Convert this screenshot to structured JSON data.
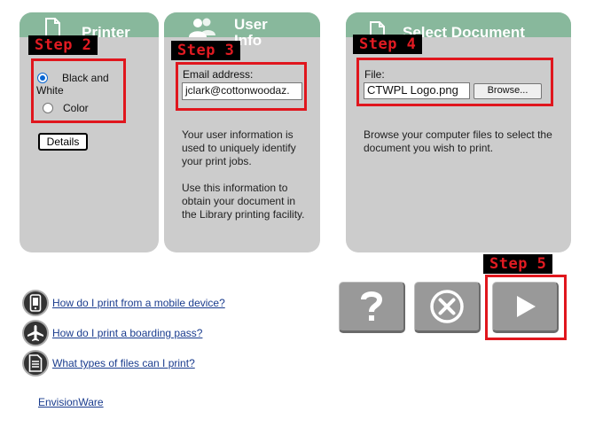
{
  "printer_panel": {
    "title": "Printer",
    "icon": "document-icon",
    "options": [
      "Black and White",
      "Color"
    ],
    "selected": "Black and White",
    "details_label": "Details"
  },
  "user_panel": {
    "title_line1": "User",
    "title_line2": "Info",
    "icon": "users-icon",
    "email_label": "Email address:",
    "email_value": "jclark@cottonwoodaz.",
    "help_paragraph1": "Your user information is used to uniquely identify your print jobs.",
    "help_paragraph2": "Use this information to obtain your document in the Library printing facility."
  },
  "document_panel": {
    "title": "Select Document",
    "icon": "document-icon",
    "file_label": "File:",
    "file_value": "CTWPL Logo.png",
    "browse_label": "Browse...",
    "help_text": "Browse your computer files to select the document you wish to print."
  },
  "steps": {
    "step2": "Step 2",
    "step3": "Step 3",
    "step4": "Step 4",
    "step5": "Step 5"
  },
  "actions": {
    "help_icon": "question-mark-icon",
    "cancel_icon": "cancel-circle-icon",
    "next_icon": "play-icon"
  },
  "links": {
    "mobile": "How do I print from a mobile device?",
    "boarding": "How do I print a boarding pass?",
    "file_types": "What types of files can I print?",
    "footer": "EnvisionWare"
  },
  "colors": {
    "panel_bg": "#cccccc",
    "panel_header": "#88b89c",
    "step_highlight": "#e0161d",
    "action_button": "#999999",
    "link": "#1a3c8e"
  }
}
